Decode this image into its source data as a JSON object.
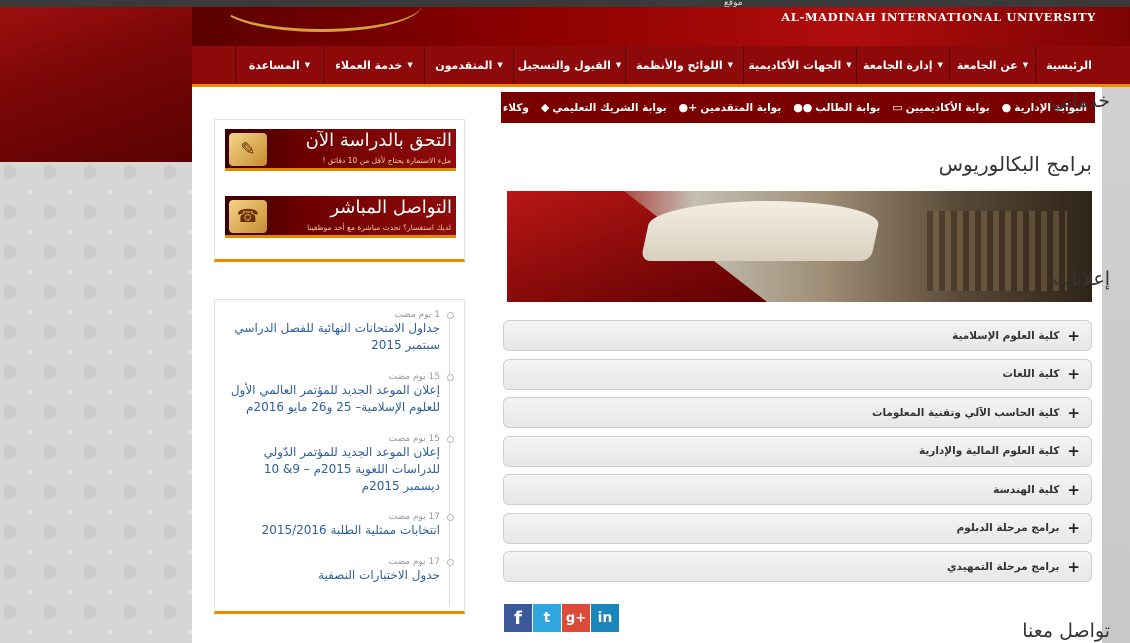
{
  "topbar": {
    "mini": "ﻣﻮﻗﻊ"
  },
  "header": {
    "university_name": "AL-MADINAH INTERNATIONAL UNIVERSITY"
  },
  "nav": {
    "items": [
      {
        "label": "الرئيسية",
        "has_caret": false
      },
      {
        "label": "عن الجامعة",
        "has_caret": true
      },
      {
        "label": "إدارة الجامعة",
        "has_caret": true
      },
      {
        "label": "الجهات الأكاديمية",
        "has_caret": true
      },
      {
        "label": "اللوائح والأنظمة",
        "has_caret": true
      },
      {
        "label": "القبول والتسجيل",
        "has_caret": true
      },
      {
        "label": "المتقدمون",
        "has_caret": true
      },
      {
        "label": "خدمة العملاء",
        "has_caret": true
      },
      {
        "label": "المساعدة",
        "has_caret": true
      }
    ]
  },
  "portals": [
    {
      "label": "البوابة الإدارية",
      "icon": "user-icon"
    },
    {
      "label": "بوابة الأكاديميين",
      "icon": "laptop-icon"
    },
    {
      "label": "بوابة الطالب",
      "icon": "users-icon"
    },
    {
      "label": "بوابة المتقدمين",
      "icon": "user-plus-icon"
    },
    {
      "label": "بوابة الشريك التعليمي",
      "icon": "graduation-cap-icon"
    },
    {
      "label": "وكلاء التسويق",
      "icon": "person-icon"
    }
  ],
  "main": {
    "page_title": "برامج البكالوريوس",
    "accordion": [
      "كلية العلوم الإسلامية",
      "كلية اللغات",
      "كلية الحاسب الآلي وتقنية المعلومات",
      "كلية العلوم المالية والإدارية",
      "كلية الهندسة",
      "برامج مرحلة الدبلوم",
      "برامج مرحلة التمهيدي"
    ]
  },
  "sidebar": {
    "services_title": "خدماتي",
    "services": [
      {
        "title": "التحق بالدراسة الآن",
        "subtitle": "ملء الاستمارة يحتاج لأقل من 10 دقائق !",
        "icon": "scroll-icon"
      },
      {
        "title": "التواصل المباشر",
        "subtitle": "لديك استفسار؟ تحدث مباشرة مع أحد موظفينا",
        "icon": "headset-icon"
      }
    ],
    "announcements_title": "إعلانات",
    "announcements": [
      {
        "date": "1 يوم مضت",
        "text": "جداول الامتحانات النهائية للفصل الدراسي سبتمبر 2015"
      },
      {
        "date": "15 يوم مضت",
        "text": "إعلان الموعد الجديد للمؤتمر العالمي الأول للعلوم الإسلامية– 25 و26 مايو 2016م"
      },
      {
        "date": "15 يوم مضت",
        "text": "إعلان الموعد الجديد للمؤتمر الدّولي للدراسات اللغوية 2015م – 9& 10 ديسمبر 2015م"
      },
      {
        "date": "17 يوم مضت",
        "text": "انتخابات ممثلية الطلبة 2015/2016"
      },
      {
        "date": "17 يوم مضت",
        "text": "جدول الاختبارات النصفية"
      }
    ],
    "contact_title": "تواصل معنا"
  },
  "social": [
    {
      "name": "facebook",
      "glyph": "f"
    },
    {
      "name": "twitter",
      "glyph": "t"
    },
    {
      "name": "google-plus",
      "glyph": "g+"
    },
    {
      "name": "linkedin",
      "glyph": "in"
    }
  ]
}
